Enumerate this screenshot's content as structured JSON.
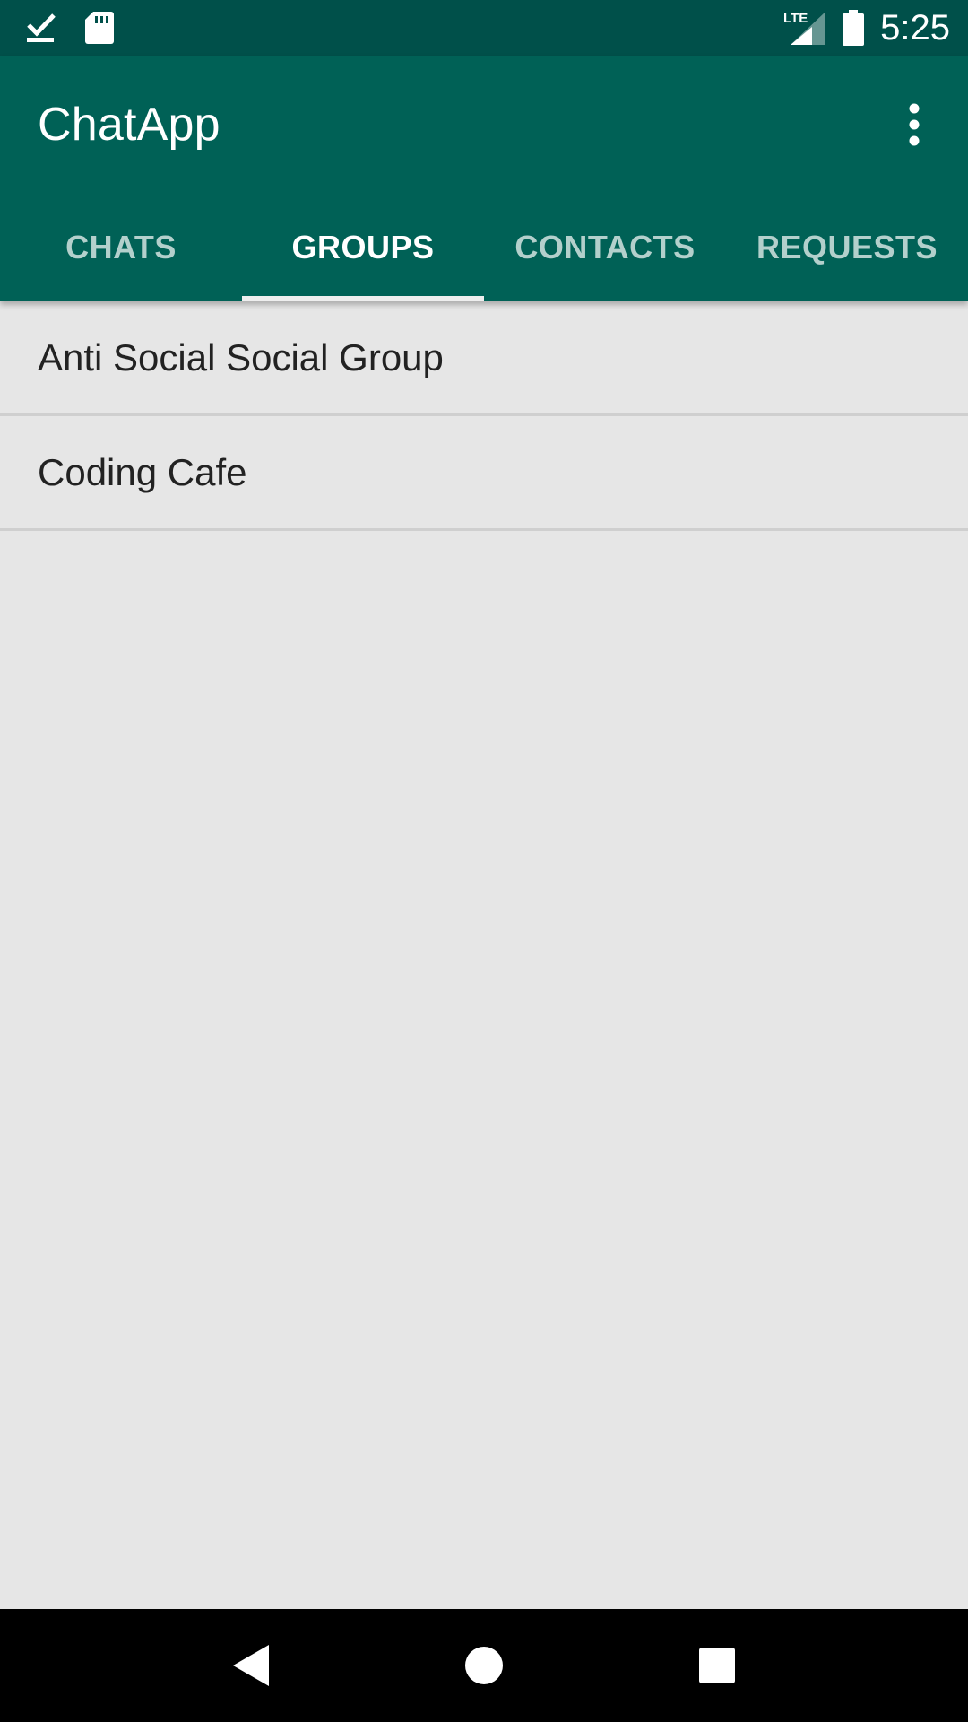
{
  "status_bar": {
    "left_icons": [
      "download-done-icon",
      "sd-card-icon"
    ],
    "network_label": "LTE",
    "time": "5:25"
  },
  "app_bar": {
    "title": "ChatApp",
    "overflow_icon": "more-vert-icon"
  },
  "tabs": [
    {
      "label": "CHATS",
      "active": false
    },
    {
      "label": "GROUPS",
      "active": true
    },
    {
      "label": "CONTACTS",
      "active": false
    },
    {
      "label": "REQUESTS",
      "active": false
    }
  ],
  "groups": [
    {
      "name": "Anti Social Social Group"
    },
    {
      "name": "Coding Cafe"
    }
  ],
  "nav_bar": {
    "back_icon": "back-icon",
    "home_icon": "home-icon",
    "recents_icon": "recents-icon"
  },
  "colors": {
    "status_bar": "#00504A",
    "app_bar": "#006156",
    "background": "#E6E6E6",
    "tab_indicator": "#EEEEEE",
    "nav_bar": "#000000"
  }
}
